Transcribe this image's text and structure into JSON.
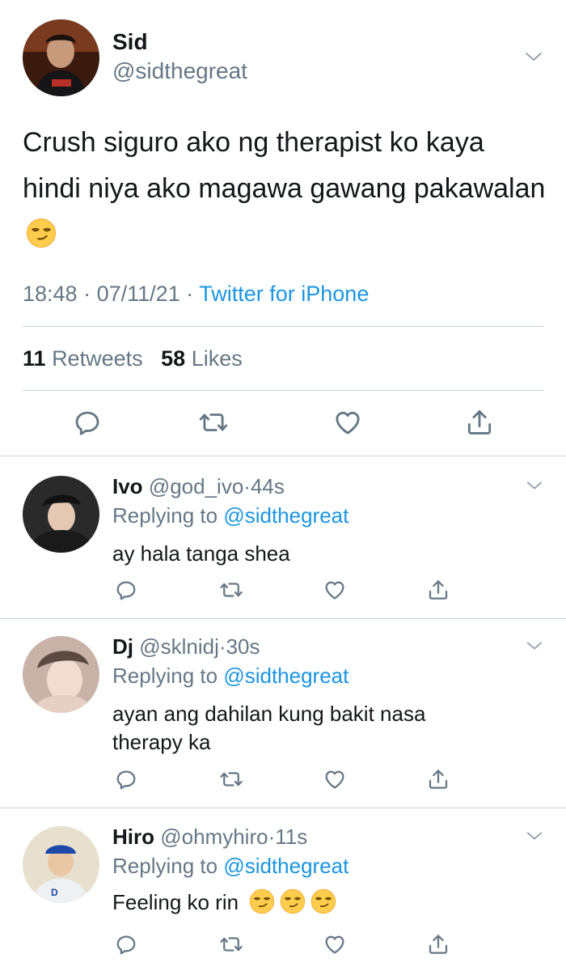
{
  "main_tweet": {
    "name": "Sid",
    "handle": "@sidthegreat",
    "text": "Crush siguro ako ng therapist ko kaya hindi niya ako magawa gawang pakawalan",
    "time": "18:48",
    "date": "07/11/21",
    "source": "Twitter for iPhone",
    "retweets_count": "11",
    "retweets_label": "Retweets",
    "likes_count": "58",
    "likes_label": "Likes"
  },
  "replies": [
    {
      "name": "Ivo",
      "handle": "@god_ivo",
      "time": "44s",
      "replying_prefix": "Replying to",
      "replying_handle": "@sidthegreat",
      "text": "ay hala tanga shea"
    },
    {
      "name": "Dj",
      "handle": "@sklnidj",
      "time": "30s",
      "replying_prefix": "Replying to",
      "replying_handle": "@sidthegreat",
      "text": "ayan ang dahilan kung bakit nasa therapy ka"
    },
    {
      "name": "Hiro",
      "handle": "@ohmyhiro",
      "time": "11s",
      "replying_prefix": "Replying to",
      "replying_handle": "@sidthegreat",
      "text": "Feeling ko rin"
    }
  ],
  "separator": "·",
  "icons": {
    "reply": "reply-icon",
    "retweet": "retweet-icon",
    "like": "heart-icon",
    "share": "share-icon",
    "more": "chevron-down-icon",
    "emoji": "smirking-face-emoji"
  },
  "colors": {
    "link": "#1b95e0",
    "secondary_text": "#657786",
    "divider": "#ccd6dd",
    "icon": "#657786"
  }
}
